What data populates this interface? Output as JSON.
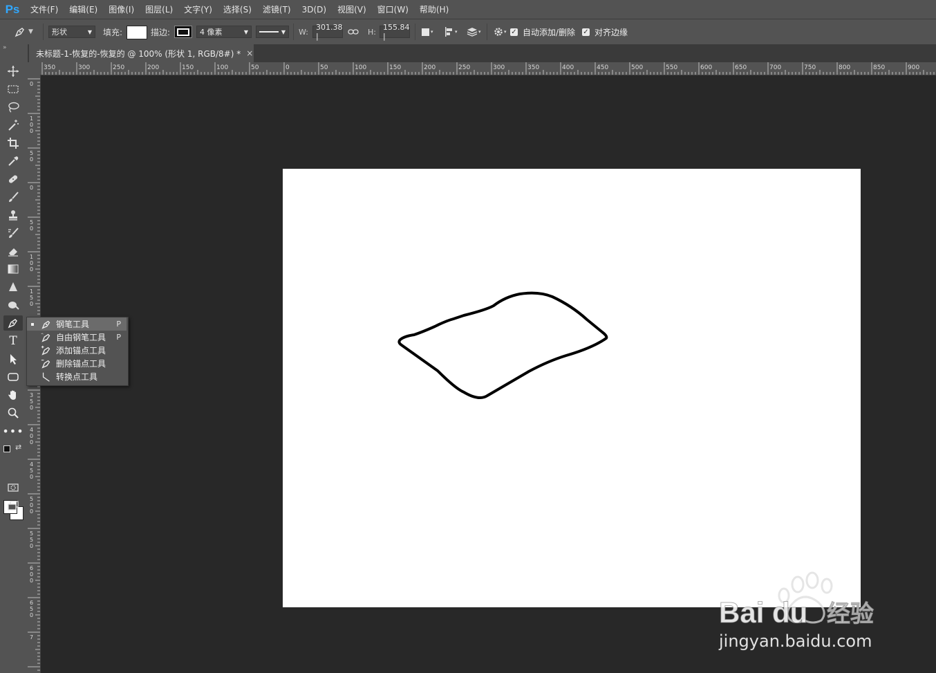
{
  "app": {
    "logo": "Ps"
  },
  "menu": [
    "文件(F)",
    "编辑(E)",
    "图像(I)",
    "图层(L)",
    "文字(Y)",
    "选择(S)",
    "滤镜(T)",
    "3D(D)",
    "视图(V)",
    "窗口(W)",
    "帮助(H)"
  ],
  "options": {
    "mode_value": "形状",
    "fill_label": "填充:",
    "stroke_label": "描边:",
    "stroke_width_value": "4 像素",
    "w_label": "W:",
    "w_value": "301.38 |",
    "h_label": "H:",
    "h_value": "155.84 |",
    "auto_add_label": "自动添加/删除",
    "align_edges_label": "对齐边缘"
  },
  "document": {
    "tab_title": "未标题-1-恢复的-恢复的 @ 100% (形状 1, RGB/8#) *",
    "close_glyph": "×"
  },
  "ruler": {
    "top_labels": [
      "350",
      "300",
      "250",
      "200",
      "150",
      "100",
      "50",
      "0",
      "50",
      "100",
      "150",
      "200",
      "250",
      "300",
      "350",
      "400",
      "450",
      "500",
      "550",
      "600",
      "650",
      "700",
      "750",
      "800",
      "850",
      "900"
    ],
    "left_labels": [
      "0",
      "100",
      "50",
      "0",
      "50",
      "100",
      "150",
      "2",
      "0",
      "350",
      "400",
      "450",
      "500",
      "550",
      "600",
      "650",
      "7"
    ]
  },
  "flyout": {
    "items": [
      {
        "label": "钢笔工具",
        "key": "P",
        "icon": "pen-icon",
        "selected": true
      },
      {
        "label": "自由钢笔工具",
        "key": "P",
        "icon": "freeform-pen-icon",
        "selected": false
      },
      {
        "label": "添加锚点工具",
        "key": "",
        "icon": "add-anchor-icon",
        "selected": false
      },
      {
        "label": "删除锚点工具",
        "key": "",
        "icon": "delete-anchor-icon",
        "selected": false
      },
      {
        "label": "转换点工具",
        "key": "",
        "icon": "convert-point-icon",
        "selected": false
      }
    ]
  },
  "watermark": {
    "brand": "Bai du",
    "product": "经验",
    "url": "jingyan.baidu.com"
  }
}
